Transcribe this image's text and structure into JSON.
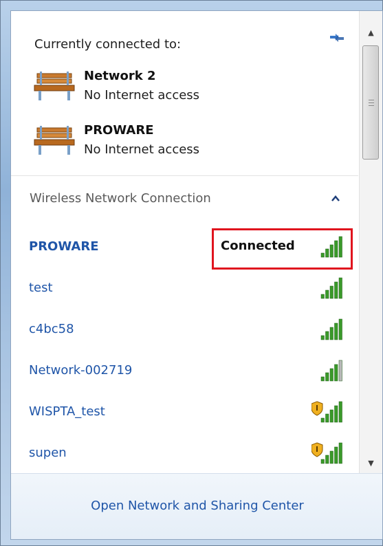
{
  "header": {
    "label": "Currently connected to:"
  },
  "connections": [
    {
      "name": "Network  2",
      "status": "No Internet access",
      "icon": "bench-network-icon"
    },
    {
      "name": "PROWARE",
      "status": "No Internet access",
      "icon": "bench-network-icon"
    }
  ],
  "wireless": {
    "section_label": "Wireless Network Connection",
    "networks": [
      {
        "name": "PROWARE",
        "status": "Connected",
        "signal_bars": 5,
        "secured": false
      },
      {
        "name": "test",
        "status": "",
        "signal_bars": 5,
        "secured": false
      },
      {
        "name": "c4bc58",
        "status": "",
        "signal_bars": 5,
        "secured": false
      },
      {
        "name": "Network-002719",
        "status": "",
        "signal_bars": 4,
        "secured": false
      },
      {
        "name": "WISPTA_test",
        "status": "",
        "signal_bars": 5,
        "secured": true
      },
      {
        "name": "supen",
        "status": "",
        "signal_bars": 5,
        "secured": true
      }
    ]
  },
  "footer": {
    "link": "Open Network and Sharing Center"
  },
  "colors": {
    "link": "#1f55a8",
    "highlight": "#e0141e",
    "signal": "#3a9a2a"
  }
}
